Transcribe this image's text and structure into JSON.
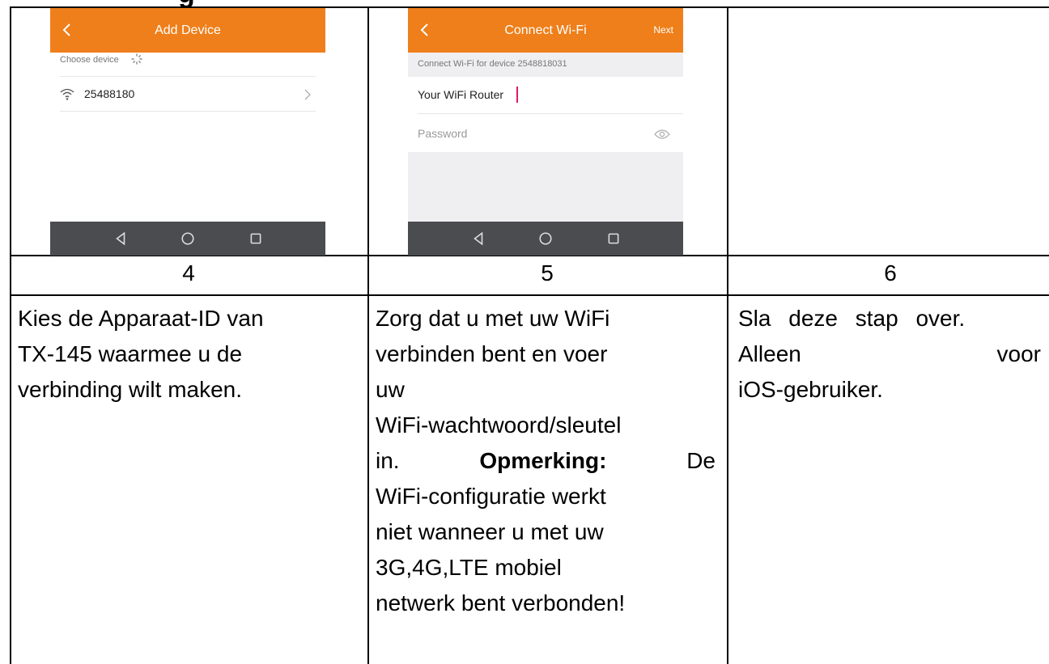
{
  "heading_fragment": "g",
  "steps": [
    {
      "number": "4",
      "screen": {
        "title": "Add Device",
        "choose_label": "Choose device",
        "device_id": "25488180"
      },
      "lines": [
        "Kies de Apparaat-ID van",
        "TX-145 waarmee u de",
        "verbinding wilt maken."
      ]
    },
    {
      "number": "5",
      "screen": {
        "title": "Connect Wi-Fi",
        "next_label": "Next",
        "connect_label": "Connect Wi-Fi for device 2548818031",
        "ssid_value": "Your WiFi Router",
        "password_placeholder": "Password"
      },
      "lines": [
        "Zorg dat u met uw WiFi",
        "verbinden bent en voer",
        "uw",
        "WiFi-wachtwoord/sleutel",
        "in.",
        "Opmerking:",
        "De",
        "WiFi-configuratie werkt",
        "niet wanneer u met uw",
        "3G,4G,LTE mobiel",
        "netwerk bent verbonden!"
      ]
    },
    {
      "number": "6",
      "lines": [
        "Sla deze stap over.",
        "Alleen",
        "voor",
        "iOS-gebruiker."
      ]
    }
  ],
  "colors": {
    "appbar": "#ef7f1a",
    "navbar": "#4a4c50"
  },
  "icons": [
    "back-arrow-icon",
    "wifi-icon",
    "chevron-right-icon",
    "loading-spinner-icon",
    "eye-icon",
    "nav-back-icon",
    "nav-home-icon",
    "nav-recents-icon"
  ]
}
